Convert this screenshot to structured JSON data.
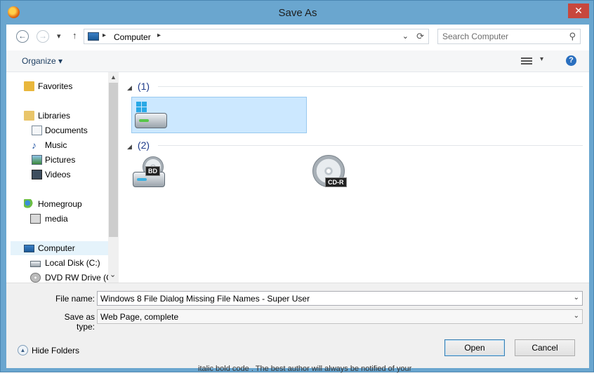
{
  "window": {
    "title": "Save As",
    "close_glyph": "✕",
    "app_icon": "firefox-icon"
  },
  "nav": {
    "back_glyph": "←",
    "forward_glyph": "→",
    "recent_glyph": "▾",
    "up_glyph": "↑"
  },
  "address": {
    "crumb": "Computer",
    "sep": "▸",
    "dropdown_glyph": "⌄",
    "refresh_glyph": "⟳"
  },
  "search": {
    "placeholder": "Search Computer",
    "icon_glyph": "⚲"
  },
  "toolbar": {
    "organize": "Organize ▾",
    "view_dropdown_glyph": "▾",
    "help_glyph": "?"
  },
  "sidebar": {
    "scroll_up_glyph": "▲",
    "items": [
      {
        "label": "Favorites",
        "icon": "star-folder-icon"
      },
      {
        "label": "Libraries",
        "icon": "libraries-icon"
      },
      {
        "label": "Documents",
        "icon": "documents-icon"
      },
      {
        "label": "Music",
        "icon": "music-icon"
      },
      {
        "label": "Pictures",
        "icon": "pictures-icon"
      },
      {
        "label": "Videos",
        "icon": "videos-icon"
      },
      {
        "label": "Homegroup",
        "icon": "homegroup-icon"
      },
      {
        "label": "media",
        "icon": "user-icon"
      },
      {
        "label": "Computer",
        "icon": "computer-icon"
      },
      {
        "label": "Local Disk (C:)",
        "icon": "local-disk-icon"
      },
      {
        "label": "DVD RW Drive (G",
        "icon": "dvd-drive-icon"
      }
    ],
    "more_glyph": "⌄"
  },
  "content": {
    "group_toggle_glyph": "◢",
    "groups": [
      {
        "label": "(1)"
      },
      {
        "label": "(2)"
      }
    ],
    "disc_labels": {
      "bd": "BD",
      "cdr": "CD-R"
    }
  },
  "form": {
    "file_name_label": "File name:",
    "file_name_value": "Windows 8  File Dialog Missing File Names - Super User",
    "save_type_label": "Save as type:",
    "save_type_value": "Web Page, complete",
    "dropdown_glyph": "⌄",
    "hide_folders": "Hide Folders",
    "hide_glyph": "▲",
    "open": "Open",
    "cancel": "Cancel"
  },
  "background_text": "italic     bold     code . The best author will always be notified of your"
}
